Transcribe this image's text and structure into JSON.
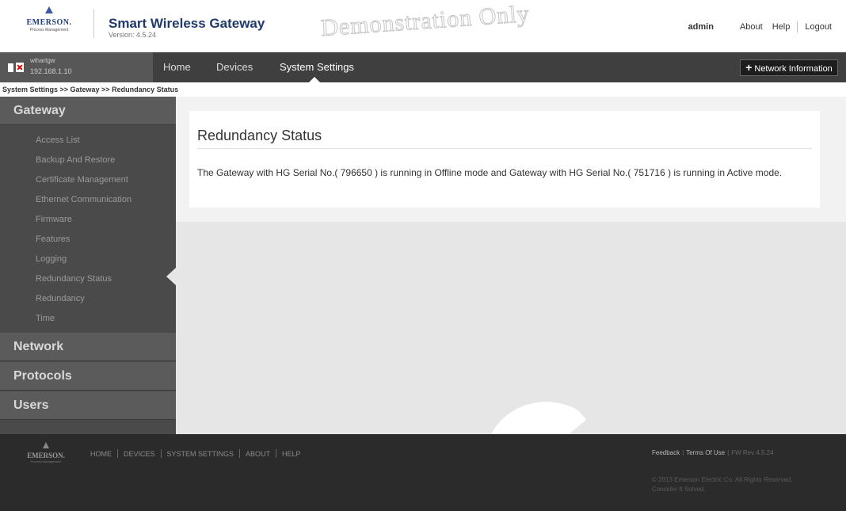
{
  "header": {
    "brand": "EMERSON.",
    "brand_sub": "Process Management",
    "app_title": "Smart Wireless Gateway",
    "version": "Version: 4.5.24",
    "watermark": "Demonstration Only",
    "user": "admin",
    "about": "About",
    "help": "Help",
    "logout": "Logout"
  },
  "navbar": {
    "gateway_name": "wihartgw",
    "gateway_ip": "192.168.1.10",
    "home": "Home",
    "devices": "Devices",
    "system_settings": "System Settings",
    "network_info": "Network Information"
  },
  "breadcrumb": "System Settings >> Gateway >> Redundancy Status",
  "sidebar": {
    "gateway": "Gateway",
    "items": [
      "Access List",
      "Backup And Restore",
      "Certificate Management",
      "Ethernet Communication",
      "Firmware",
      "Features",
      "Logging",
      "Redundancy Status",
      "Redundancy",
      "Time"
    ],
    "network": "Network",
    "protocols": "Protocols",
    "users": "Users"
  },
  "main": {
    "title": "Redundancy Status",
    "message": "The Gateway with HG Serial No.( 796650 ) is running in Offline mode and Gateway with HG Serial No.( 751716 ) is running in Active mode."
  },
  "footer": {
    "brand": "EMERSON.",
    "brand_sub": "Process Management",
    "links": [
      "HOME",
      "DEVICES",
      "SYSTEM SETTINGS",
      "ABOUT",
      "HELP"
    ],
    "feedback": "Feedback",
    "terms": "Terms Of Use",
    "fw_rev": "FW Rev 4.5.24",
    "copyright": "© 2013 Emerson Electric Co. All Rights Reserved.",
    "tagline": "Consider It Solved."
  },
  "colors": {
    "navbar_bg": "#3f3f3f",
    "sidebar_bg": "#4a4a4a",
    "footer_bg": "#2b2b2b",
    "title_blue": "#1f3a6b"
  }
}
